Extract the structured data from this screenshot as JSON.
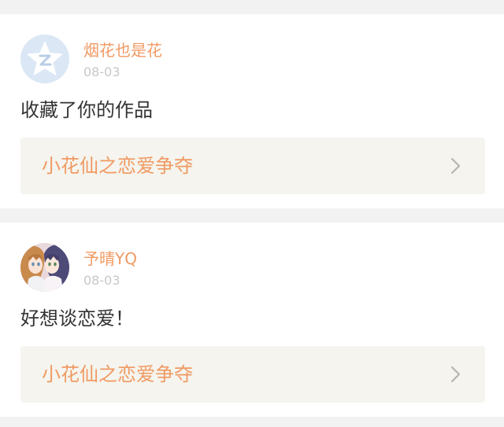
{
  "notifications": [
    {
      "username": "烟花也是花",
      "date": "08-03",
      "message": "收藏了你的作品",
      "work_title": "小花仙之恋爱争夺",
      "avatar_icon": "default-qzone-avatar-icon"
    },
    {
      "username": "予晴YQ",
      "date": "08-03",
      "message": "好想谈恋爱！",
      "work_title": "小花仙之恋爱争夺",
      "avatar_icon": "anime-girls-avatar"
    }
  ],
  "colors": {
    "accent": "#f09a63",
    "date": "#c8c8c8",
    "text": "#333333",
    "link_bg": "#f5f4ee",
    "page_bg": "#f2f2f2"
  }
}
